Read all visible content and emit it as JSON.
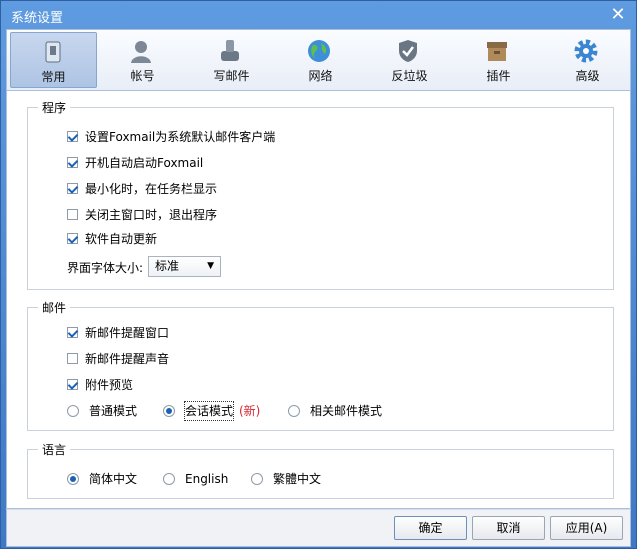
{
  "window": {
    "title": "系统设置"
  },
  "tabs": [
    {
      "label": "常用",
      "icon": "general-icon"
    },
    {
      "label": "帐号",
      "icon": "account-icon"
    },
    {
      "label": "写邮件",
      "icon": "compose-icon"
    },
    {
      "label": "网络",
      "icon": "network-icon"
    },
    {
      "label": "反垃圾",
      "icon": "antispam-icon"
    },
    {
      "label": "插件",
      "icon": "plugin-icon"
    },
    {
      "label": "高级",
      "icon": "advanced-icon"
    }
  ],
  "program": {
    "title": "程序",
    "options": [
      {
        "label": "设置Foxmail为系统默认邮件客户端",
        "checked": true
      },
      {
        "label": "开机自动启动Foxmail",
        "checked": true
      },
      {
        "label": "最小化时，在任务栏显示",
        "checked": true
      },
      {
        "label": "关闭主窗口时，退出程序",
        "checked": false
      },
      {
        "label": "软件自动更新",
        "checked": true
      }
    ],
    "font_size_label": "界面字体大小:",
    "font_size_value": "标准"
  },
  "mail": {
    "title": "邮件",
    "options": [
      {
        "label": "新邮件提醒窗口",
        "checked": true
      },
      {
        "label": "新邮件提醒声音",
        "checked": false
      },
      {
        "label": "附件预览",
        "checked": true
      }
    ],
    "modes": [
      {
        "label": "普通模式",
        "selected": false
      },
      {
        "label": "会话模式",
        "selected": true,
        "tag": "(新)"
      },
      {
        "label": "相关邮件模式",
        "selected": false
      }
    ]
  },
  "language": {
    "title": "语言",
    "options": [
      {
        "label": "简体中文",
        "selected": true
      },
      {
        "label": "English",
        "selected": false
      },
      {
        "label": "繁體中文",
        "selected": false
      }
    ]
  },
  "buttons": {
    "ok": "确定",
    "cancel": "取消",
    "apply": "应用(A)"
  },
  "colors": {
    "accent": "#1b62b7",
    "new_tag": "#d9262f"
  }
}
